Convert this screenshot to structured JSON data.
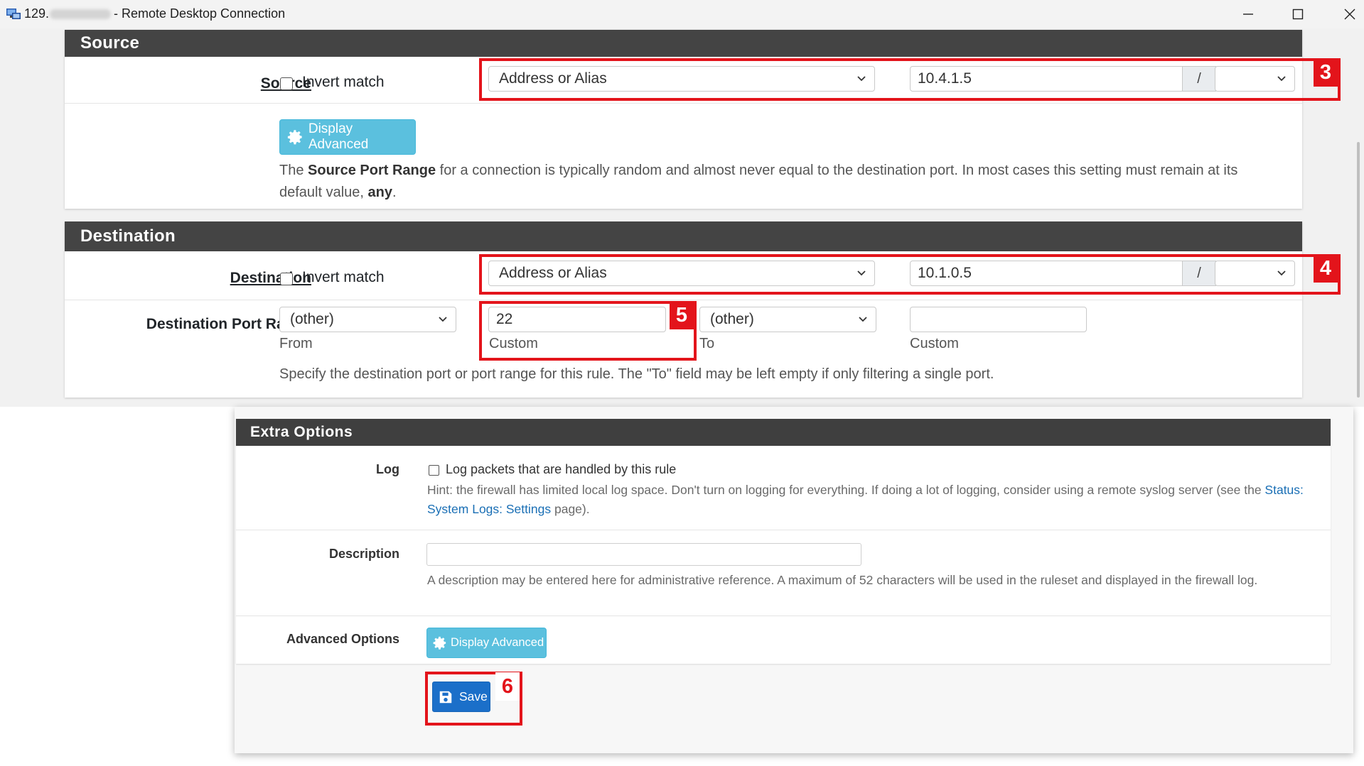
{
  "window": {
    "title_ip": "129.",
    "title": "- Remote Desktop Connection"
  },
  "source": {
    "section_title": "Source",
    "label": "Source",
    "invert_label": "Invert match",
    "type_select": "Address or Alias",
    "address": "10.4.1.5",
    "mask_sep": "/",
    "mask_select": "",
    "display_advanced": "Display Advanced",
    "help_pre": "The ",
    "help_bold": "Source Port Range",
    "help_mid": " for a connection is typically random and almost never equal to the destination port. In most cases this setting must remain at its default value, ",
    "help_any": "any",
    "help_end": ".",
    "callout_number": "3"
  },
  "destination": {
    "section_title": "Destination",
    "label": "Destination",
    "invert_label": "Invert match",
    "type_select": "Address or Alias",
    "address": "10.1.0.5",
    "mask_sep": "/",
    "mask_select": "",
    "callout_number": "4",
    "port_range": {
      "label": "Destination Port Range",
      "from_select": "(other)",
      "from_label": "From",
      "from_custom": "22",
      "from_custom_label": "Custom",
      "to_select": "(other)",
      "to_label": "To",
      "to_custom": "",
      "to_custom_label": "Custom",
      "help": "Specify the destination port or port range for this rule. The \"To\" field may be left empty if only filtering a single port.",
      "callout_number": "5"
    }
  },
  "extra_options": {
    "section_title": "Extra Options",
    "log_label": "Log",
    "log_checkbox_text": "Log packets that are handled by this rule",
    "log_hint_pre": "Hint: the firewall has limited local log space. Don't turn on logging for everything. If doing a lot of logging, consider using a remote syslog server (see the ",
    "log_hint_link": "Status: System Logs: Settings",
    "log_hint_end": " page).",
    "description_label": "Description",
    "description_value": "",
    "description_help": "A description may be entered here for administrative reference. A maximum of 52 characters will be used in the ruleset and displayed in the firewall log.",
    "advanced_label": "Advanced Options",
    "display_advanced": "Display Advanced",
    "save_label": "Save",
    "callout_number": "6"
  },
  "colors": {
    "callout": "#e3141b",
    "panel_header": "#444444",
    "info_button": "#5bc0de",
    "primary_button": "#1b6fc9",
    "link": "#1a6fb5"
  }
}
